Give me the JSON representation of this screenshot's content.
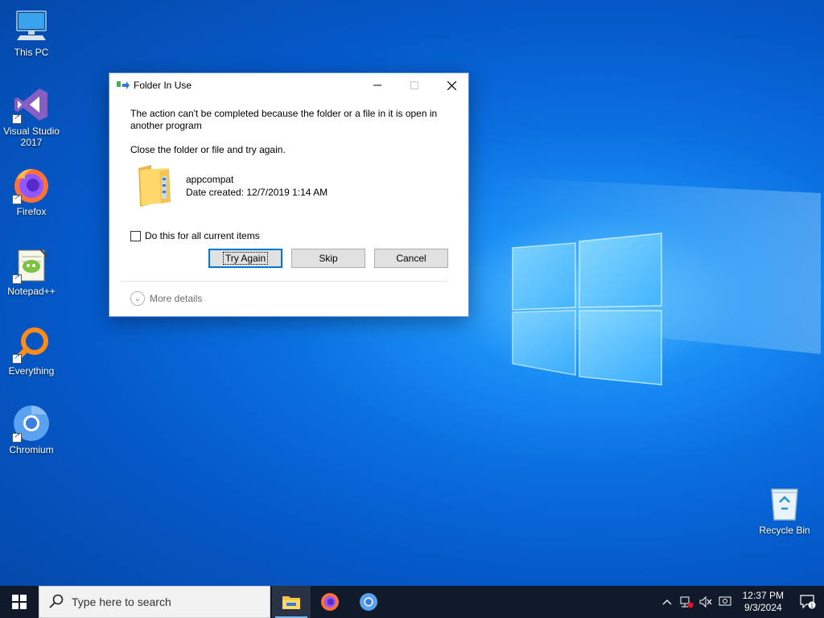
{
  "desktop": {
    "icons": [
      {
        "label": "This PC",
        "icon": "computer-icon"
      },
      {
        "label": "Visual Studio 2017",
        "icon": "visual-studio-icon"
      },
      {
        "label": "Firefox",
        "icon": "firefox-icon"
      },
      {
        "label": "Notepad++",
        "icon": "notepadpp-icon"
      },
      {
        "label": "Everything",
        "icon": "everything-search-icon"
      },
      {
        "label": "Chromium",
        "icon": "chromium-icon"
      },
      {
        "label": "Recycle Bin",
        "icon": "recycle-bin-icon"
      }
    ]
  },
  "dialog": {
    "title": "Folder In Use",
    "message": "The action can't be completed because the folder or a file in it is open in another program",
    "instruction": "Close the folder or file and try again.",
    "file_name": "appcompat",
    "file_date": "Date created: 12/7/2019 1:14 AM",
    "checkbox_label": "Do this for all current items",
    "checkbox_checked": false,
    "buttons": {
      "try_again": "Try Again",
      "skip": "Skip",
      "cancel": "Cancel"
    },
    "more_details": "More details"
  },
  "taskbar": {
    "search_placeholder": "Type here to search",
    "apps": [
      "file-explorer-icon",
      "firefox-icon",
      "chromium-icon"
    ],
    "clock_time": "12:37 PM",
    "clock_date": "9/3/2024",
    "notification_count": "1"
  },
  "colors": {
    "accent": "#0078d7",
    "taskbar": "#101a2a"
  }
}
